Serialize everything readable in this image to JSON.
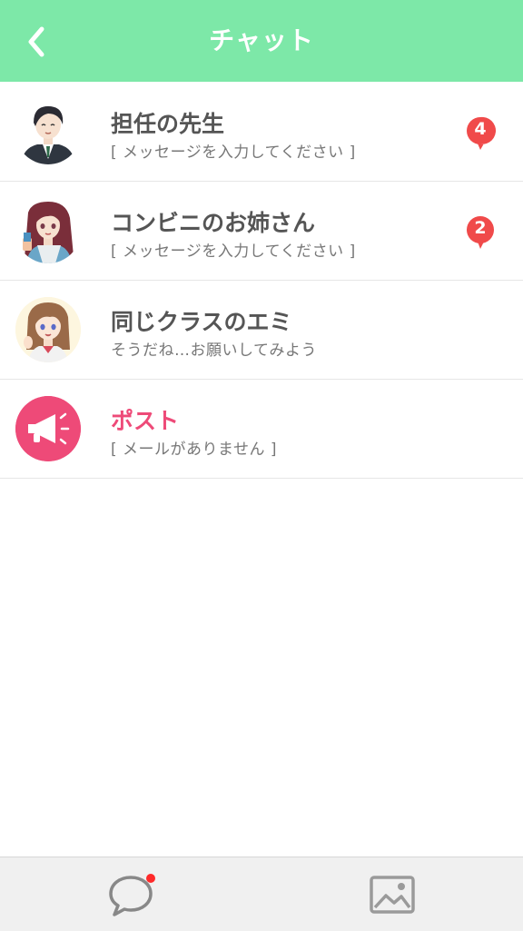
{
  "header": {
    "title": "チャット"
  },
  "chats": [
    {
      "name": "担任の先生",
      "preview": "[ メッセージを入力してください ]",
      "badge": "4"
    },
    {
      "name": "コンビニのお姉さん",
      "preview": "[ メッセージを入力してください ]",
      "badge": "2"
    },
    {
      "name": "同じクラスのエミ",
      "preview": "そうだね…お願いしてみよう"
    },
    {
      "name": "ポスト",
      "preview": "[ メールがありません ]"
    }
  ],
  "colors": {
    "header": "#7de8a8",
    "badge": "#f04a4a",
    "post_accent": "#ee4a78",
    "tab_icon": "#888888"
  }
}
